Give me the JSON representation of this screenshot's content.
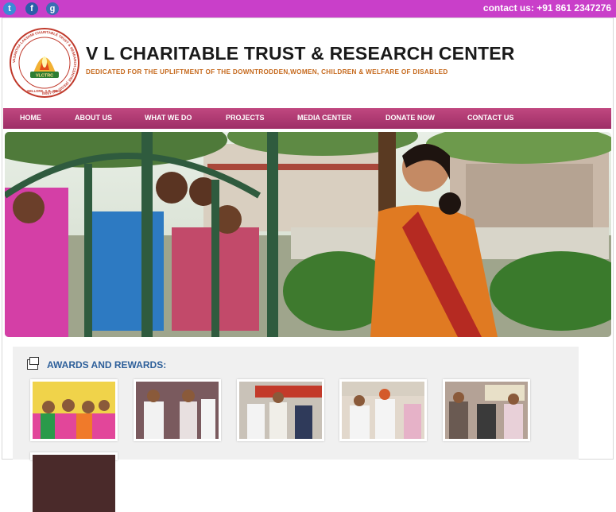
{
  "social": [
    {
      "icon": "twitter-icon",
      "glyph": "t"
    },
    {
      "icon": "facebook-icon",
      "glyph": "f"
    },
    {
      "icon": "google-icon",
      "glyph": "g"
    }
  ],
  "contact": "contact us: +91 861 2347276",
  "header": {
    "title": "V L CHARITABLE TRUST & RESEARCH CENTER",
    "tagline": "DEDICATED FOR THE UPLIFTMENT OF THE DOWNTRODDEN,WOMEN, CHILDREN  & WELFARE OF DISABLED",
    "logo_ring_text": "VASANTHA LAKSHMI CHARITABLE TRUST & RESEARCH CENTRE (REGD. NO.1808)",
    "logo_bottom_text": "NELLORE, A.P., INDIA",
    "logo_center_text": "VLCTRC"
  },
  "nav": [
    "HOME",
    "ABOUT US",
    "WHAT WE DO",
    "PROJECTS",
    "MEDIA CENTER",
    "DONATE NOW",
    "CONTACT US"
  ],
  "awards": {
    "title": "AWARDS AND REWARDS:"
  },
  "colors": {
    "topbar": "#c93fc9",
    "nav": "#b03a74",
    "title": "#1a1a1a",
    "tagline": "#c66a1e",
    "awards_title": "#2d5f9a"
  }
}
